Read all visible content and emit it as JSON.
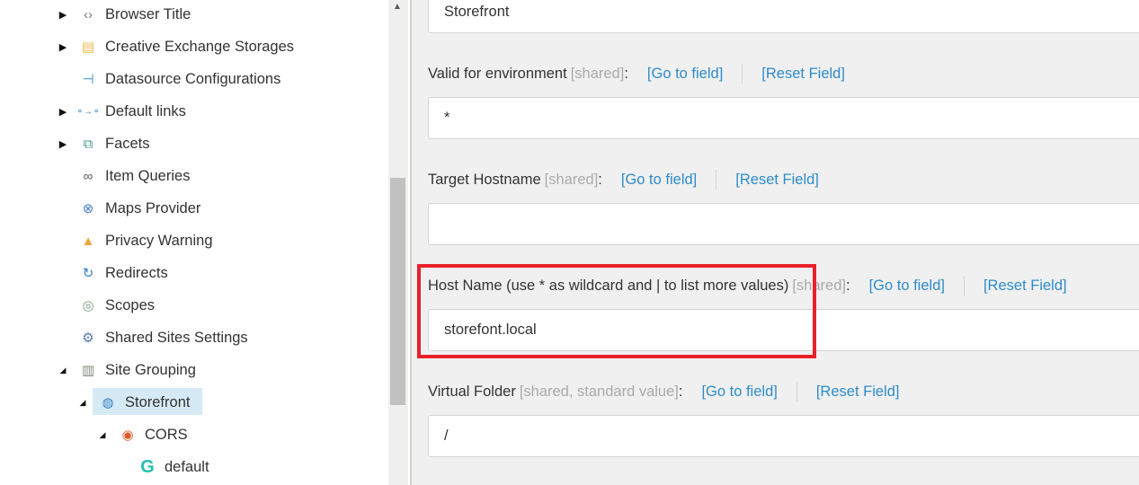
{
  "tree": {
    "items": [
      {
        "label": "Browser Title",
        "icon": "code-document-icon",
        "expand": "collapsed"
      },
      {
        "label": "Creative Exchange Storages",
        "icon": "storage-icon",
        "expand": "collapsed"
      },
      {
        "label": "Datasource Configurations",
        "icon": "signpost-icon",
        "expand": "none"
      },
      {
        "label": "Default links",
        "icon": "link-chain-icon",
        "expand": "collapsed"
      },
      {
        "label": "Facets",
        "icon": "facets-icon",
        "expand": "collapsed"
      },
      {
        "label": "Item Queries",
        "icon": "binoculars-icon",
        "expand": "none"
      },
      {
        "label": "Maps Provider",
        "icon": "compass-icon",
        "expand": "none"
      },
      {
        "label": "Privacy Warning",
        "icon": "warning-window-icon",
        "expand": "none"
      },
      {
        "label": "Redirects",
        "icon": "redirect-icon",
        "expand": "none"
      },
      {
        "label": "Scopes",
        "icon": "scopes-icon",
        "expand": "none"
      },
      {
        "label": "Shared Sites Settings",
        "icon": "settings-gear-icon",
        "expand": "none"
      },
      {
        "label": "Site Grouping",
        "icon": "server-icon",
        "expand": "expanded"
      },
      {
        "label": "Storefront",
        "icon": "site-globe-icon",
        "expand": "expanded",
        "selected": true
      },
      {
        "label": "CORS",
        "icon": "cors-icon",
        "expand": "expanded"
      },
      {
        "label": "default",
        "icon": "refresh-g-icon",
        "expand": "none"
      }
    ]
  },
  "fields": {
    "top_value": "Storefront",
    "go_to_field": "[Go to field]",
    "reset_field": "[Reset Field]",
    "items": [
      {
        "label": "Valid for environment",
        "meta": "[shared]",
        "value": "*"
      },
      {
        "label": "Target Hostname",
        "meta": "[shared]",
        "value": ""
      },
      {
        "label": "Host Name (use * as wildcard and | to list more values)",
        "meta": "[shared]",
        "value": "storefont.local"
      },
      {
        "label": "Virtual Folder",
        "meta": "[shared, standard value]",
        "value": "/"
      }
    ]
  },
  "colors": {
    "highlight": "#e8202a",
    "link": "#2e8bc9",
    "selected": "#d6eaf5"
  }
}
